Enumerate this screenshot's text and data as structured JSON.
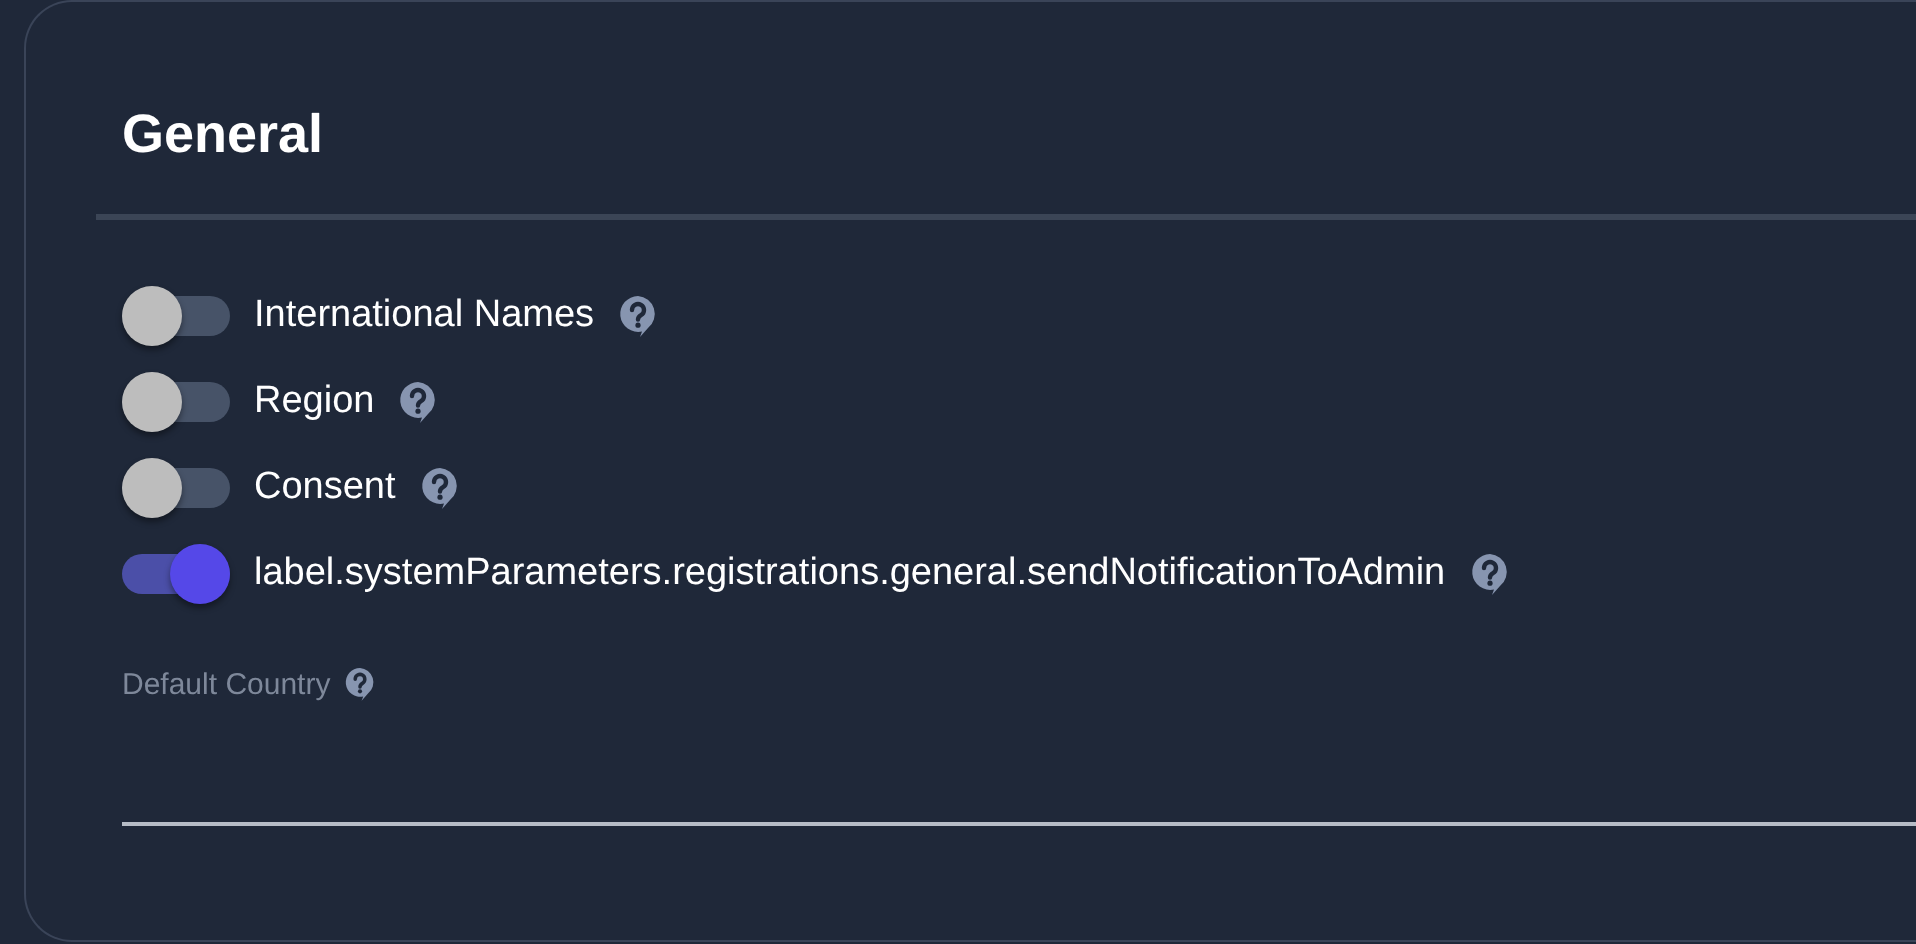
{
  "section": {
    "title": "General"
  },
  "toggles": [
    {
      "label": "International Names",
      "on": false
    },
    {
      "label": "Region",
      "on": false
    },
    {
      "label": "Consent",
      "on": false
    },
    {
      "label": "label.systemParameters.registrations.general.sendNotificationToAdmin",
      "on": true
    }
  ],
  "default_country": {
    "label": "Default Country"
  }
}
